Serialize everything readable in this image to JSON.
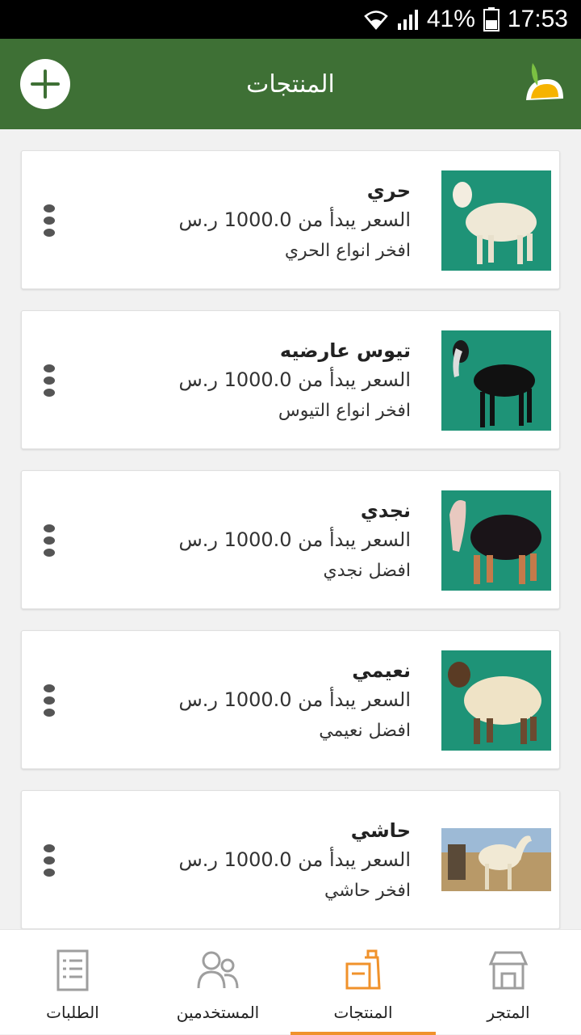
{
  "status_bar": {
    "battery": "41%",
    "time": "17:53"
  },
  "app_bar": {
    "title": "المنتجات",
    "add_icon": "plus-icon",
    "logo_icon": "leaf-logo-icon"
  },
  "products": [
    {
      "name": "حري",
      "price": "السعر يبدأ من 1000.0 ر.س",
      "description": "افخر انواع الحري",
      "image": "white-sheep"
    },
    {
      "name": "تيوس عارضيه",
      "price": "السعر يبدأ من 1000.0 ر.س",
      "description": "افخر انواع التيوس",
      "image": "black-goat"
    },
    {
      "name": "نجدي",
      "price": "السعر يبدأ من 1000.0 ر.س",
      "description": "افضل نجدي",
      "image": "black-sheep"
    },
    {
      "name": "نعيمي",
      "price": "السعر يبدأ من 1000.0 ر.س",
      "description": "افضل نعيمي",
      "image": "cream-sheep"
    },
    {
      "name": "حاشي",
      "price": "السعر يبدأ من 1000.0 ر.س",
      "description": "افخر حاشي",
      "image": "camel"
    }
  ],
  "bottom_nav": [
    {
      "label": "الطلبات",
      "icon": "orders-list-icon",
      "active": false
    },
    {
      "label": "المستخدمين",
      "icon": "users-icon",
      "active": false
    },
    {
      "label": "المنتجات",
      "icon": "products-icon",
      "active": true
    },
    {
      "label": "المتجر",
      "icon": "store-icon",
      "active": false
    }
  ],
  "colors": {
    "app_bar": "#3e7035",
    "accent": "#f0922b",
    "image_bg": "#1e9377"
  }
}
